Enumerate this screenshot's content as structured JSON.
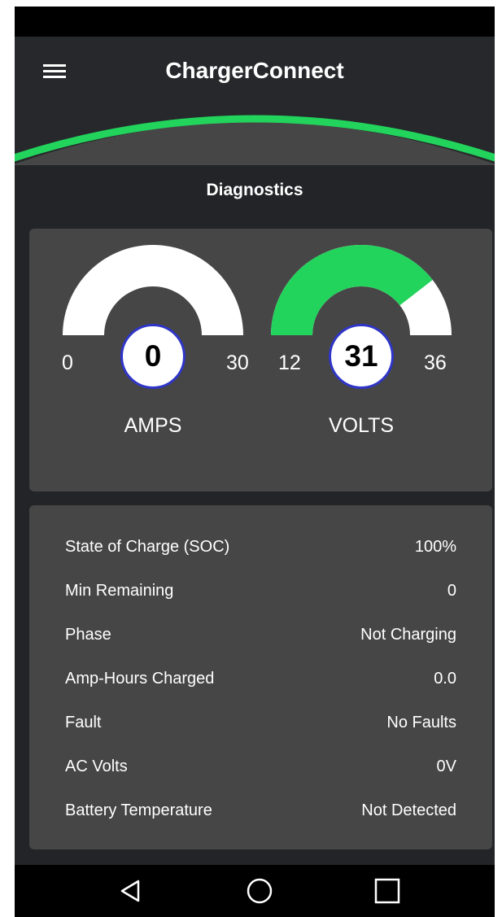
{
  "app": {
    "title": "ChargerConnect",
    "menu_icon": "hamburger-menu-icon",
    "accent_color": "#22d35c"
  },
  "section": {
    "title": "Diagnostics"
  },
  "gauges": [
    {
      "label": "AMPS",
      "min": "0",
      "max": "30",
      "value": "0",
      "fill_fraction": 0.0
    },
    {
      "label": "VOLTS",
      "min": "12",
      "max": "36",
      "value": "31",
      "fill_fraction": 0.79
    }
  ],
  "info": {
    "rows": [
      {
        "label": "State of Charge (SOC)",
        "value": "100%"
      },
      {
        "label": "Min Remaining",
        "value": "0"
      },
      {
        "label": "Phase",
        "value": "Not Charging"
      },
      {
        "label": "Amp-Hours Charged",
        "value": "0.0"
      },
      {
        "label": "Fault",
        "value": "No Faults"
      },
      {
        "label": "AC Volts",
        "value": "0V"
      },
      {
        "label": "Battery Temperature",
        "value": "Not Detected"
      }
    ]
  },
  "nav": {
    "back_icon": "back-triangle-icon",
    "home_icon": "home-circle-icon",
    "recents_icon": "recents-square-icon"
  }
}
